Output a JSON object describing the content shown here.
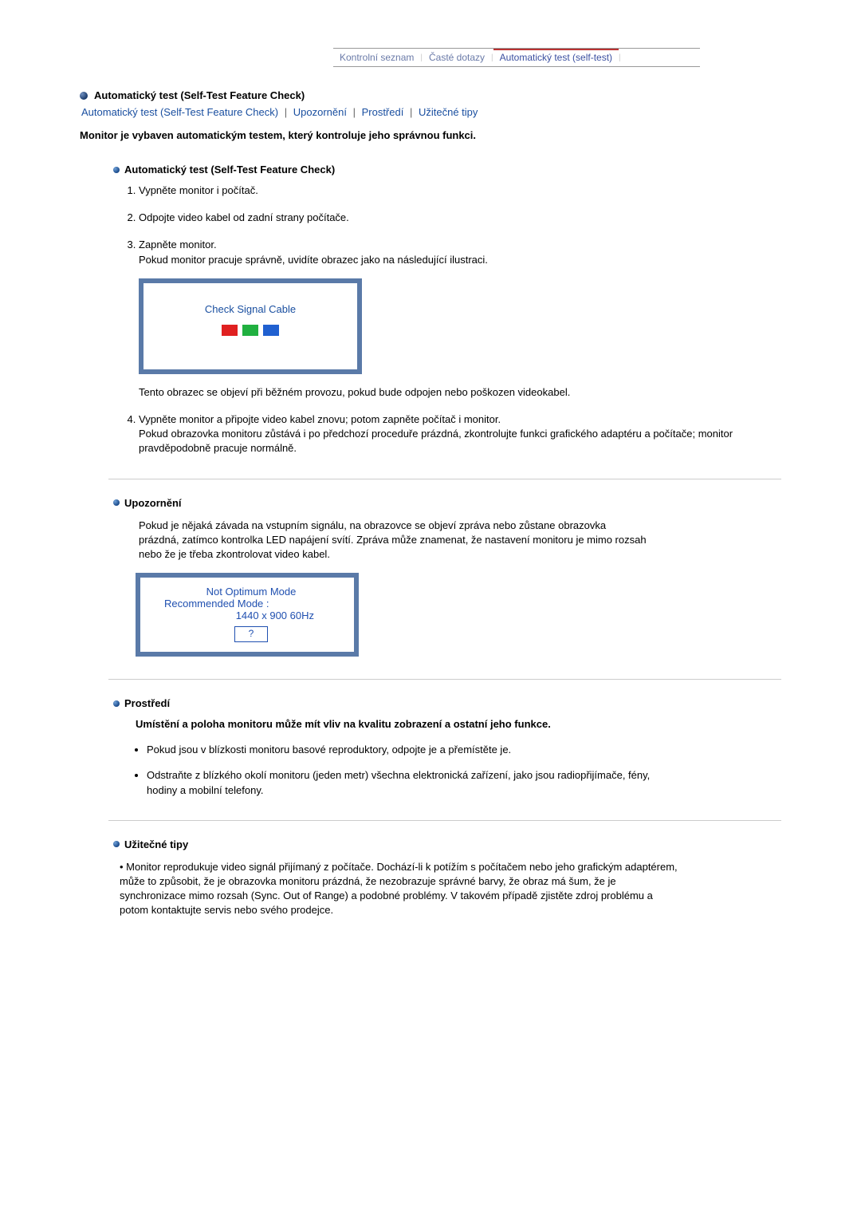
{
  "tabs": {
    "items": [
      {
        "label": "Kontrolní seznam"
      },
      {
        "label": "Časté dotazy"
      },
      {
        "label": "Automatický test (self-test)"
      }
    ]
  },
  "heading": {
    "title": "Automatický test (Self-Test Feature Check)"
  },
  "anchors": {
    "a1": "Automatický test (Self-Test Feature Check)",
    "a2": "Upozornění",
    "a3": "Prostředí",
    "a4": "Užitečné tipy",
    "sep": "|"
  },
  "intro": "Monitor je vybaven automatickým testem, který kontroluje jeho správnou funkci.",
  "section1": {
    "title": "Automatický test (Self-Test Feature Check)",
    "items": {
      "i1": "Vypněte monitor i počítač.",
      "i2": "Odpojte video kabel od zadní strany počítače.",
      "i3a": "Zapněte monitor.",
      "i3b": "Pokud monitor pracuje správně, uvidíte obrazec jako na následující ilustraci.",
      "i3_illustration": "Check Signal Cable",
      "i3c": "Tento obrazec se objeví při běžném provozu, pokud bude odpojen nebo poškozen videokabel.",
      "i4a": "Vypněte monitor a připojte video kabel znovu; potom zapněte počítač i monitor.",
      "i4b": "Pokud obrazovka monitoru zůstává i po předchozí proceduře prázdná, zkontrolujte funkci grafického adaptéru a počítače; monitor pravděpodobně pracuje normálně."
    }
  },
  "section2": {
    "title": "Upozornění",
    "body": "Pokud je nějaká závada na vstupním signálu, na obrazovce se objeví zpráva nebo zůstane obrazovka prázdná, zatímco kontrolka LED napájení svítí. Zpráva může znamenat, že nastavení monitoru je mimo rozsah nebo že je třeba zkontrolovat video kabel.",
    "ill": {
      "l1": "Not Optimum Mode",
      "l2": "Recommended Mode :",
      "l3": "1440 x 900 60Hz",
      "btn": "?"
    }
  },
  "section3": {
    "title": "Prostředí",
    "bold": "Umístění a poloha monitoru může mít vliv na kvalitu zobrazení a ostatní jeho funkce.",
    "b1": "Pokud jsou v blízkosti monitoru basové reproduktory, odpojte je a přemístěte je.",
    "b2": "Odstraňte z blízkého okolí monitoru (jeden metr) všechna elektronická zařízení, jako jsou radiopřijímače, fény, hodiny a mobilní telefony."
  },
  "section4": {
    "title": "Užitečné tipy",
    "body": "Monitor reprodukuje video signál přijímaný z počítače. Dochází-li k potížím s počítačem nebo jeho grafickým adaptérem, může to způsobit, že je obrazovka monitoru prázdná, že nezobrazuje správné barvy, že obraz má šum, že je synchronizace mimo rozsah (Sync. Out of Range) a podobné problémy. V takovém případě zjistěte zdroj problému a potom kontaktujte servis nebo svého prodejce."
  }
}
